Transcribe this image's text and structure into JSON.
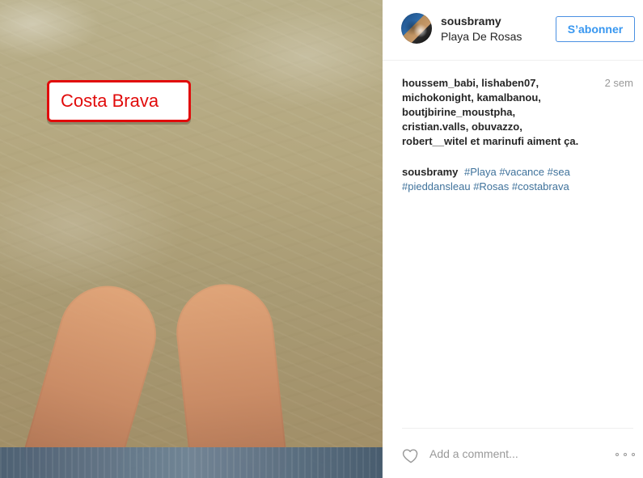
{
  "post": {
    "overlay_label": "Costa Brava"
  },
  "header": {
    "username": "sousbramy",
    "location": "Playa De Rosas",
    "follow_label": "S’abonner"
  },
  "likes": {
    "lines": [
      "houssem_babi, lishaben07,",
      "michokonight, kamalbanou,",
      "boutjbirine_moustpha,",
      "cristian.valls, obuvazzo,",
      "robert__witel et marinufi aiment ça."
    ],
    "time": "2 sem"
  },
  "caption": {
    "user": "sousbramy",
    "text_before": "",
    "hashtags_line1": "#Playa #vacance #sea",
    "hashtags_line2": "#pieddansleau #Rosas #costabrava"
  },
  "comment": {
    "placeholder": "Add a comment..."
  },
  "icons": {
    "heart": "heart-icon",
    "more": "more-icon"
  }
}
